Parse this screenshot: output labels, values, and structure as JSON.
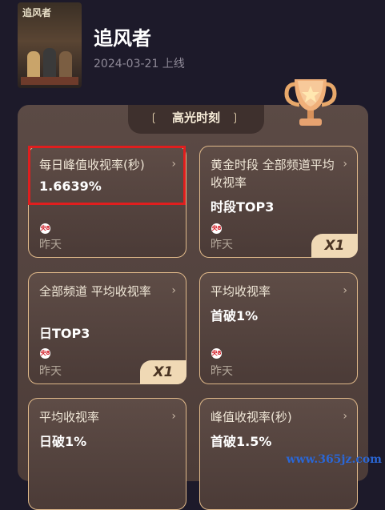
{
  "show": {
    "poster_title": "追风者",
    "title": "追风者",
    "date": "2024-03-21 上线"
  },
  "highlights": {
    "section_title": "高光时刻",
    "cards": [
      {
        "label": "每日峰值收视率(秒)",
        "value": "1.6639%",
        "channel_icon": "cctv8-icon",
        "channel_text": "央8",
        "day": "昨天",
        "multiplier": ""
      },
      {
        "label": "黄金时段 全部频道平均收视率",
        "value": "时段TOP3",
        "channel_icon": "cctv8-icon",
        "channel_text": "央8",
        "day": "昨天",
        "multiplier": "X1"
      },
      {
        "label": "全部频道 平均收视率",
        "value": "日TOP3",
        "channel_icon": "cctv8-icon",
        "channel_text": "央8",
        "day": "昨天",
        "multiplier": "X1"
      },
      {
        "label": "平均收视率",
        "value": "首破1%",
        "channel_icon": "cctv8-icon",
        "channel_text": "央8",
        "day": "昨天",
        "multiplier": ""
      },
      {
        "label": "平均收视率",
        "value": "日破1%",
        "channel_icon": "",
        "channel_text": "",
        "day": "",
        "multiplier": ""
      },
      {
        "label": "峰值收视率(秒)",
        "value": "首破1.5%",
        "channel_icon": "",
        "channel_text": "",
        "day": "",
        "multiplier": ""
      }
    ],
    "chevron": "›"
  },
  "watermark": "www.365jz.com",
  "colors": {
    "highlight_border": "#e01e1e",
    "card_border": "#e0b98a",
    "badge_bg": "#f0d9b5"
  }
}
